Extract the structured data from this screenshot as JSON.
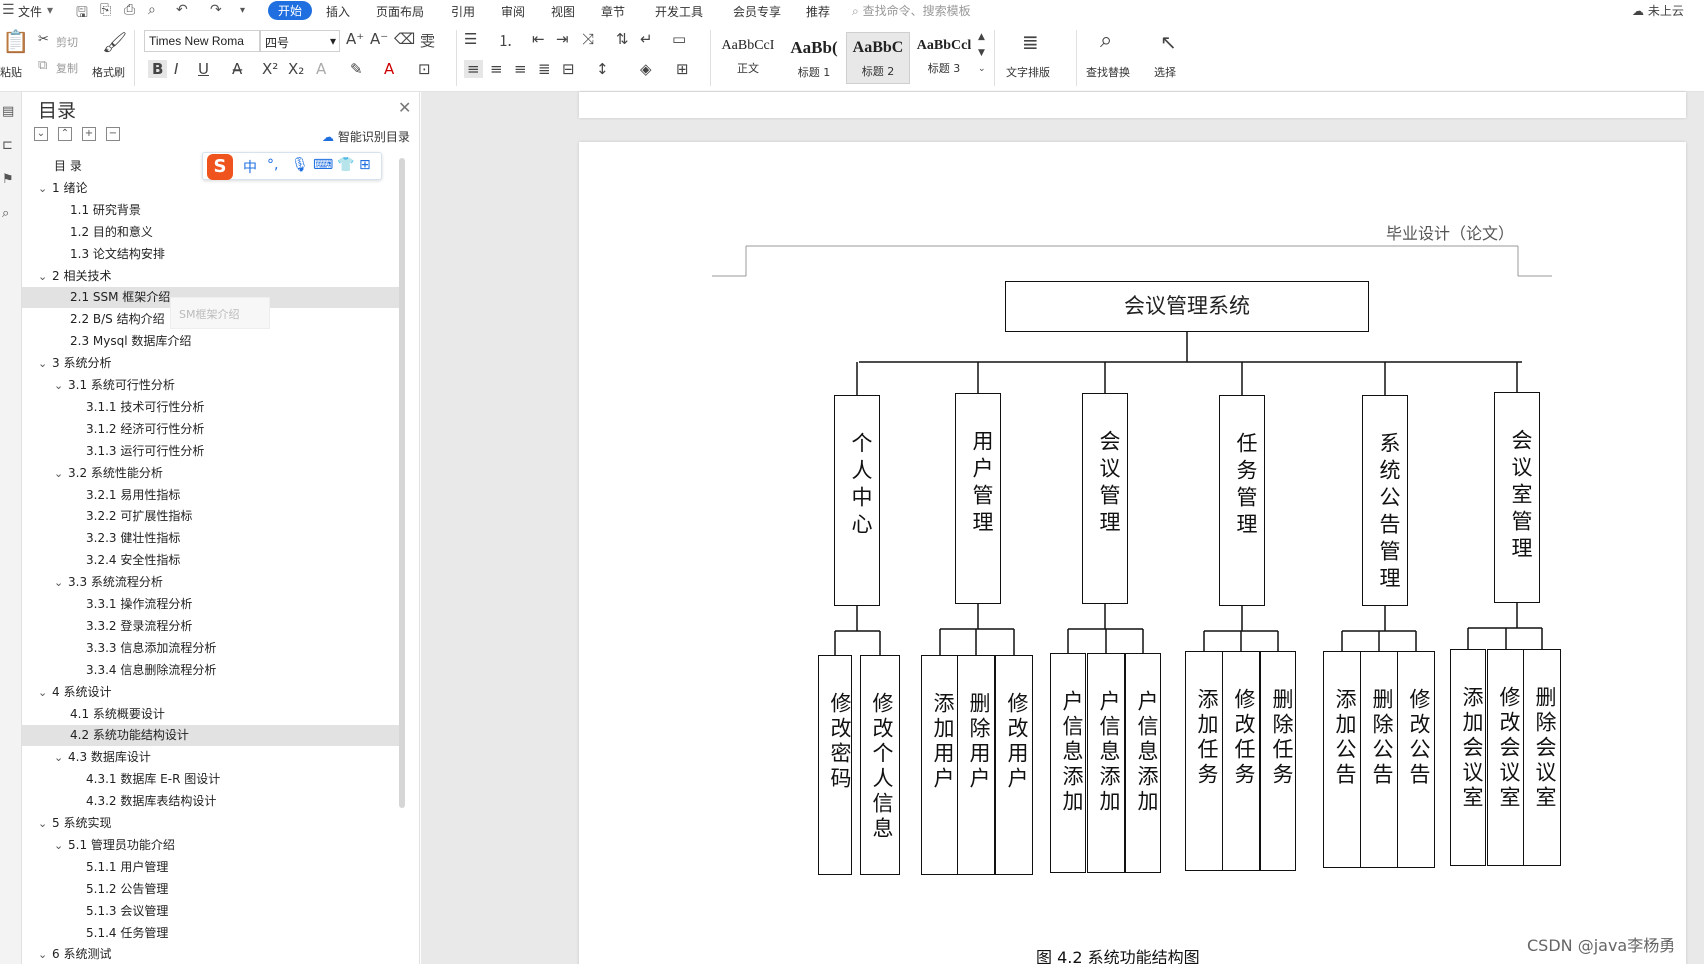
{
  "menubar": {
    "file": "文件",
    "tabs": [
      "开始",
      "插入",
      "页面布局",
      "引用",
      "审阅",
      "视图",
      "章节",
      "开发工具",
      "会员专享",
      "推荐"
    ],
    "active_tab": "开始",
    "search_placeholder": "查找命令、搜索模板",
    "cloud_label": "未上云"
  },
  "ribbon": {
    "paste": "粘贴",
    "cut": "剪切",
    "copy": "复制",
    "format_painter": "格式刷",
    "font_name": "Times New Roma",
    "font_size": "四号",
    "styles": [
      {
        "preview": "AaBbCcI",
        "label": "正文"
      },
      {
        "preview": "AaBb(",
        "label": "标题 1"
      },
      {
        "preview": "AaBbC",
        "label": "标题 2"
      },
      {
        "preview": "AaBbCcl",
        "label": "标题 3"
      }
    ],
    "text_layout": "文字排版",
    "find_replace": "查找替换",
    "select": "选择"
  },
  "toc": {
    "title": "目录",
    "smart_label": "智能识别目录",
    "tooltip": "SM框架介绍",
    "items": [
      {
        "text": "目 录",
        "level": 0,
        "chevron": false,
        "hl": false
      },
      {
        "text": "1  绪论",
        "level": 0,
        "chevron": true,
        "hl": false
      },
      {
        "text": "1.1  研究背景",
        "level": 1,
        "chevron": false,
        "hl": false
      },
      {
        "text": "1.2  目的和意义",
        "level": 1,
        "chevron": false,
        "hl": false
      },
      {
        "text": "1.3  论文结构安排",
        "level": 1,
        "chevron": false,
        "hl": false
      },
      {
        "text": "2  相关技术",
        "level": 0,
        "chevron": true,
        "hl": false
      },
      {
        "text": "2.1 SSM 框架介绍",
        "level": 1,
        "chevron": false,
        "hl": true
      },
      {
        "text": "2.2 B/S 结构介绍",
        "level": 1,
        "chevron": false,
        "hl": false
      },
      {
        "text": "2.3 Mysql 数据库介绍",
        "level": 1,
        "chevron": false,
        "hl": false
      },
      {
        "text": "3  系统分析",
        "level": 0,
        "chevron": true,
        "hl": false
      },
      {
        "text": "3.1  系统可行性分析",
        "level": 1,
        "chevron": true,
        "hl": false
      },
      {
        "text": "3.1.1  技术可行性分析",
        "level": 2,
        "chevron": false,
        "hl": false
      },
      {
        "text": "3.1.2  经济可行性分析",
        "level": 2,
        "chevron": false,
        "hl": false
      },
      {
        "text": "3.1.3  运行可行性分析",
        "level": 2,
        "chevron": false,
        "hl": false
      },
      {
        "text": "3.2  系统性能分析",
        "level": 1,
        "chevron": true,
        "hl": false
      },
      {
        "text": "3.2.1  易用性指标",
        "level": 2,
        "chevron": false,
        "hl": false
      },
      {
        "text": "3.2.2  可扩展性指标",
        "level": 2,
        "chevron": false,
        "hl": false
      },
      {
        "text": "3.2.3  健壮性指标",
        "level": 2,
        "chevron": false,
        "hl": false
      },
      {
        "text": "3.2.4  安全性指标",
        "level": 2,
        "chevron": false,
        "hl": false
      },
      {
        "text": "3.3  系统流程分析",
        "level": 1,
        "chevron": true,
        "hl": false
      },
      {
        "text": "3.3.1  操作流程分析",
        "level": 2,
        "chevron": false,
        "hl": false
      },
      {
        "text": "3.3.2  登录流程分析",
        "level": 2,
        "chevron": false,
        "hl": false
      },
      {
        "text": "3.3.3  信息添加流程分析",
        "level": 2,
        "chevron": false,
        "hl": false
      },
      {
        "text": "3.3.4  信息删除流程分析",
        "level": 2,
        "chevron": false,
        "hl": false
      },
      {
        "text": "4  系统设计",
        "level": 0,
        "chevron": true,
        "hl": false
      },
      {
        "text": "4.1  系统概要设计",
        "level": 1,
        "chevron": false,
        "hl": false
      },
      {
        "text": "4.2  系统功能结构设计",
        "level": 1,
        "chevron": false,
        "hl": true
      },
      {
        "text": "4.3  数据库设计",
        "level": 1,
        "chevron": true,
        "hl": false
      },
      {
        "text": "4.3.1  数据库 E-R 图设计",
        "level": 2,
        "chevron": false,
        "hl": false
      },
      {
        "text": "4.3.2  数据库表结构设计",
        "level": 2,
        "chevron": false,
        "hl": false
      },
      {
        "text": "5  系统实现",
        "level": 0,
        "chevron": true,
        "hl": false
      },
      {
        "text": "5.1  管理员功能介绍",
        "level": 1,
        "chevron": true,
        "hl": false
      },
      {
        "text": "5.1.1  用户管理",
        "level": 2,
        "chevron": false,
        "hl": false
      },
      {
        "text": "5.1.2  公告管理",
        "level": 2,
        "chevron": false,
        "hl": false
      },
      {
        "text": "5.1.3  会议管理",
        "level": 2,
        "chevron": false,
        "hl": false
      },
      {
        "text": "5.1.4  任务管理",
        "level": 2,
        "chevron": false,
        "hl": false
      },
      {
        "text": "6  系统测试",
        "level": 0,
        "chevron": true,
        "hl": false
      }
    ]
  },
  "ime": {
    "zh": "中",
    "punct": "°,"
  },
  "document": {
    "header_text": "毕业设计（论文）",
    "caption": "图 4.2  系统功能结构图",
    "watermark": "CSDN @java李杨勇",
    "diagram": {
      "root": "会议管理系统",
      "modules": [
        {
          "name": "个人中心",
          "children": [
            "修改密码",
            "修改个人信息"
          ]
        },
        {
          "name": "用户管理",
          "children": [
            "添加用户",
            "删除用户",
            "修改用户"
          ]
        },
        {
          "name": "会议管理",
          "children": [
            "户信息添加",
            "户信息添加",
            "户信息添加"
          ]
        },
        {
          "name": "任务管理",
          "children": [
            "添加任务",
            "修改任务",
            "删除任务"
          ]
        },
        {
          "name": "系统公告管理",
          "children": [
            "添加公告",
            "删除公告",
            "修改公告"
          ]
        },
        {
          "name": "会议室管理",
          "children": [
            "添加会议室",
            "修改会议室",
            "删除会议室"
          ]
        }
      ]
    }
  }
}
